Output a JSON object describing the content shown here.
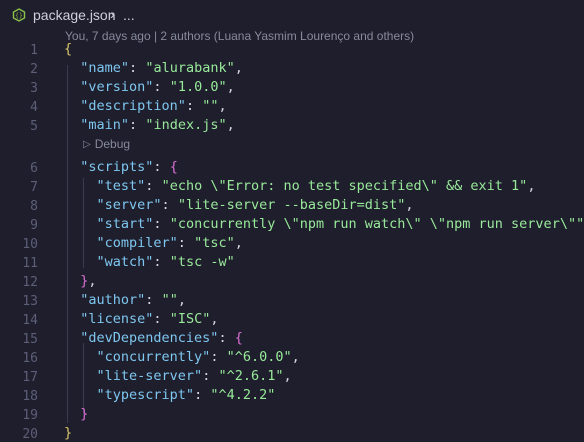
{
  "breadcrumb": {
    "filename": "package.json",
    "separator": "›",
    "more": "...",
    "file_icon": "json-file-icon"
  },
  "blame": "You, 7 days ago | 2 authors (Luana Yasmim Lourenço and others)",
  "codelens": {
    "label": "Debug",
    "icon": "play-icon"
  },
  "colors": {
    "background": "#1f1e2c",
    "key": "#7ec7f0",
    "string": "#98ea9a",
    "line_number": "#5b5f78"
  },
  "line_numbers": [
    "1",
    "2",
    "3",
    "4",
    "5",
    "6",
    "7",
    "8",
    "9",
    "10",
    "11",
    "12",
    "13",
    "14",
    "15",
    "16",
    "17",
    "18",
    "19",
    "20"
  ],
  "lines": [
    [
      {
        "t": "{",
        "c": "b1"
      }
    ],
    [
      {
        "t": "  "
      },
      {
        "t": "\"name\"",
        "c": "k"
      },
      {
        "t": ": ",
        "c": "p"
      },
      {
        "t": "\"alurabank\"",
        "c": "s"
      },
      {
        "t": ",",
        "c": "p"
      }
    ],
    [
      {
        "t": "  "
      },
      {
        "t": "\"version\"",
        "c": "k"
      },
      {
        "t": ": ",
        "c": "p"
      },
      {
        "t": "\"1.0.0\"",
        "c": "s"
      },
      {
        "t": ",",
        "c": "p"
      }
    ],
    [
      {
        "t": "  "
      },
      {
        "t": "\"description\"",
        "c": "k"
      },
      {
        "t": ": ",
        "c": "p"
      },
      {
        "t": "\"\"",
        "c": "s"
      },
      {
        "t": ",",
        "c": "p"
      }
    ],
    [
      {
        "t": "  "
      },
      {
        "t": "\"main\"",
        "c": "k"
      },
      {
        "t": ": ",
        "c": "p"
      },
      {
        "t": "\"index.js\"",
        "c": "s"
      },
      {
        "t": ",",
        "c": "p"
      }
    ],
    [
      {
        "t": "  "
      },
      {
        "t": "\"scripts\"",
        "c": "k"
      },
      {
        "t": ": ",
        "c": "p"
      },
      {
        "t": "{",
        "c": "b2"
      }
    ],
    [
      {
        "t": "    "
      },
      {
        "t": "\"test\"",
        "c": "k"
      },
      {
        "t": ": ",
        "c": "p"
      },
      {
        "t": "\"echo \\\"Error: no test specified\\\" && exit 1\"",
        "c": "s"
      },
      {
        "t": ",",
        "c": "p"
      }
    ],
    [
      {
        "t": "    "
      },
      {
        "t": "\"server\"",
        "c": "k"
      },
      {
        "t": ": ",
        "c": "p"
      },
      {
        "t": "\"lite-server --baseDir=dist\"",
        "c": "s"
      },
      {
        "t": ",",
        "c": "p"
      }
    ],
    [
      {
        "t": "    "
      },
      {
        "t": "\"start\"",
        "c": "k"
      },
      {
        "t": ": ",
        "c": "p"
      },
      {
        "t": "\"concurrently \\\"npm run watch\\\" \\\"npm run server\\\"\"",
        "c": "s"
      },
      {
        "t": ",",
        "c": "p"
      }
    ],
    [
      {
        "t": "    "
      },
      {
        "t": "\"compiler\"",
        "c": "k"
      },
      {
        "t": ": ",
        "c": "p"
      },
      {
        "t": "\"tsc\"",
        "c": "s"
      },
      {
        "t": ",",
        "c": "p"
      }
    ],
    [
      {
        "t": "    "
      },
      {
        "t": "\"watch\"",
        "c": "k"
      },
      {
        "t": ": ",
        "c": "p"
      },
      {
        "t": "\"tsc -w\"",
        "c": "s"
      }
    ],
    [
      {
        "t": "  "
      },
      {
        "t": "}",
        "c": "b2"
      },
      {
        "t": ",",
        "c": "p"
      }
    ],
    [
      {
        "t": "  "
      },
      {
        "t": "\"author\"",
        "c": "k"
      },
      {
        "t": ": ",
        "c": "p"
      },
      {
        "t": "\"\"",
        "c": "s"
      },
      {
        "t": ",",
        "c": "p"
      }
    ],
    [
      {
        "t": "  "
      },
      {
        "t": "\"license\"",
        "c": "k"
      },
      {
        "t": ": ",
        "c": "p"
      },
      {
        "t": "\"ISC\"",
        "c": "s"
      },
      {
        "t": ",",
        "c": "p"
      }
    ],
    [
      {
        "t": "  "
      },
      {
        "t": "\"devDependencies\"",
        "c": "k"
      },
      {
        "t": ": ",
        "c": "p"
      },
      {
        "t": "{",
        "c": "b2"
      }
    ],
    [
      {
        "t": "    "
      },
      {
        "t": "\"concurrently\"",
        "c": "k"
      },
      {
        "t": ": ",
        "c": "p"
      },
      {
        "t": "\"^6.0.0\"",
        "c": "s"
      },
      {
        "t": ",",
        "c": "p"
      }
    ],
    [
      {
        "t": "    "
      },
      {
        "t": "\"lite-server\"",
        "c": "k"
      },
      {
        "t": ": ",
        "c": "p"
      },
      {
        "t": "\"^2.6.1\"",
        "c": "s"
      },
      {
        "t": ",",
        "c": "p"
      }
    ],
    [
      {
        "t": "    "
      },
      {
        "t": "\"typescript\"",
        "c": "k"
      },
      {
        "t": ": ",
        "c": "p"
      },
      {
        "t": "\"^4.2.2\"",
        "c": "s"
      }
    ],
    [
      {
        "t": "  "
      },
      {
        "t": "}",
        "c": "b2"
      }
    ],
    [
      {
        "t": "}",
        "c": "b1"
      }
    ]
  ]
}
